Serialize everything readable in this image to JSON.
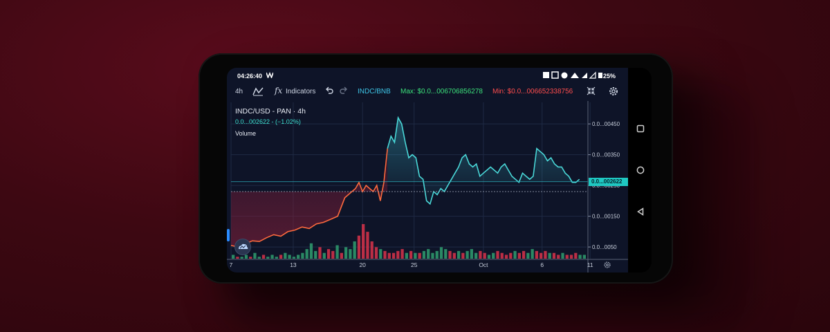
{
  "status_bar": {
    "time": "04:26:40",
    "battery": "25%"
  },
  "toolbar": {
    "interval": "4h",
    "fx_glyph": "fx",
    "indicators_label": "Indicators",
    "symbol": "INDC/BNB",
    "max_label": "Max: $0.0...006706856278",
    "min_label": "Min: $0.0...006652338756"
  },
  "legend": {
    "pair": "INDC/USD - PAN · 4h",
    "change": "0.0...002622 - (−1.02%)",
    "volume": "Volume"
  },
  "price_tag": "0.0...002622",
  "icons": {
    "app": "tradingview-w-icon",
    "chart_type": "area-chart-icon",
    "undo": "undo-icon",
    "redo": "redo-icon",
    "fullscreen": "collapse-icon",
    "settings": "gear-icon",
    "nav_square": "recent-apps-icon",
    "nav_circle": "home-icon",
    "nav_triangle": "back-icon"
  },
  "colors": {
    "up": "#4ad9d9",
    "down": "#ff6a3d",
    "up_volume": "#2f9e6e",
    "down_volume": "#d9334a",
    "background": "#0e1428"
  },
  "chart_data": {
    "type": "line",
    "x_ticks": [
      "7",
      "13",
      "20",
      "25",
      "Oct",
      "6",
      "11"
    ],
    "y_ticks": [
      "0.0...00450",
      "0.0...00350",
      "0.0...00250",
      "0.0...00150",
      "0.0...0050"
    ],
    "y_tick_values": [
      0.0045,
      0.0035,
      0.0025,
      0.0015,
      0.0005
    ],
    "ylim": [
      0.00012,
      0.0052
    ],
    "x_range": [
      0,
      100
    ],
    "price_line_value": 0.002622,
    "series": [
      {
        "role": "price",
        "x": [
          0,
          2,
          4,
          6,
          8,
          10,
          12,
          14,
          16,
          18,
          20,
          22,
          24,
          26,
          28,
          30,
          32,
          34,
          35,
          36,
          37,
          38,
          39,
          40,
          41,
          42,
          43,
          44,
          45,
          46,
          47,
          48,
          49,
          50,
          51,
          52,
          53,
          54,
          55,
          56,
          57,
          58,
          59,
          60,
          61,
          62,
          63,
          64,
          65,
          66,
          67,
          68,
          69,
          70,
          71,
          72,
          73,
          74,
          75,
          76,
          77,
          78,
          79,
          80,
          81,
          82,
          83,
          84,
          85,
          86,
          87,
          88,
          89,
          90,
          91,
          92,
          93,
          94,
          95,
          96,
          97,
          98
        ],
        "y": [
          0.00055,
          0.0005,
          0.0006,
          0.0007,
          0.00068,
          0.0008,
          0.0009,
          0.00085,
          0.001,
          0.00105,
          0.00115,
          0.0011,
          0.00125,
          0.0013,
          0.0014,
          0.0015,
          0.0021,
          0.0023,
          0.0024,
          0.0026,
          0.0023,
          0.0025,
          0.0024,
          0.0023,
          0.0025,
          0.002,
          0.0026,
          0.0037,
          0.0041,
          0.0039,
          0.0047,
          0.0045,
          0.0039,
          0.0034,
          0.0035,
          0.0034,
          0.0028,
          0.0027,
          0.002,
          0.0019,
          0.0023,
          0.0022,
          0.0024,
          0.0023,
          0.0025,
          0.0027,
          0.0029,
          0.0031,
          0.0034,
          0.0035,
          0.0032,
          0.0031,
          0.0032,
          0.0028,
          0.0029,
          0.003,
          0.0031,
          0.003,
          0.0029,
          0.0031,
          0.0032,
          0.003,
          0.0028,
          0.0027,
          0.0026,
          0.0029,
          0.0028,
          0.0027,
          0.0028,
          0.0037,
          0.0036,
          0.0035,
          0.0033,
          0.0034,
          0.0032,
          0.0031,
          0.0031,
          0.0029,
          0.0028,
          0.0026,
          0.0026,
          0.0027
        ]
      }
    ],
    "volume": [
      2,
      1,
      1,
      2,
      1,
      3,
      1,
      2,
      1,
      2,
      1,
      2,
      3,
      2,
      1,
      2,
      3,
      5,
      8,
      4,
      6,
      3,
      5,
      4,
      7,
      3,
      6,
      5,
      9,
      12,
      18,
      14,
      9,
      6,
      5,
      4,
      3,
      3,
      4,
      5,
      3,
      4,
      3,
      3,
      4,
      5,
      3,
      4,
      6,
      5,
      4,
      3,
      4,
      3,
      4,
      5,
      3,
      4,
      3,
      2,
      3,
      4,
      3,
      2,
      3,
      4,
      3,
      4,
      3,
      5,
      4,
      3,
      4,
      3,
      3,
      2,
      3,
      2,
      2,
      3,
      2,
      2
    ],
    "grid": true
  }
}
